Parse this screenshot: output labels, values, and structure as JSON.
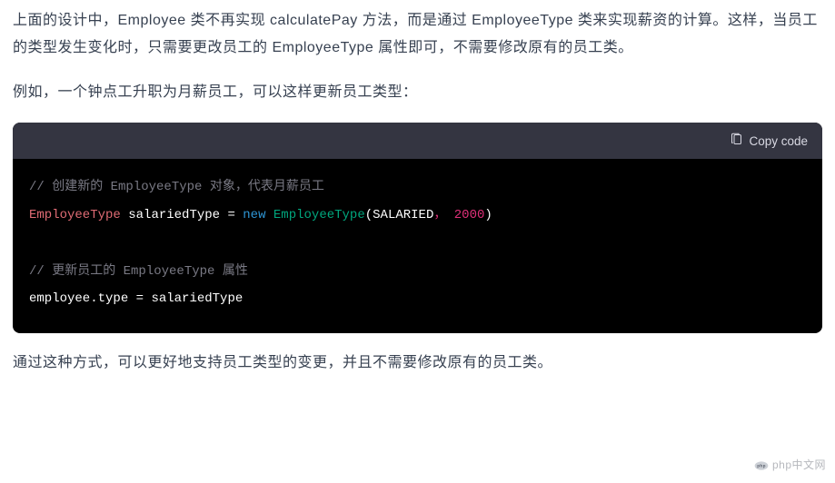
{
  "paragraphs": {
    "p1": "上面的设计中，Employee 类不再实现 calculatePay 方法，而是通过 EmployeeType 类来实现薪资的计算。这样，当员工的类型发生变化时，只需要更改员工的 EmployeeType 属性即可，不需要修改原有的员工类。",
    "p2": "例如，一个钟点工升职为月薪员工，可以这样更新员工类型：",
    "p3": "通过这种方式，可以更好地支持员工类型的变更，并且不需要修改原有的员工类。"
  },
  "code_header": {
    "copy_label": "Copy code"
  },
  "code": {
    "line1_comment": "// 创建新的 EmployeeType 对象，代表月薪员工",
    "line2": {
      "type": "EmployeeType",
      "ident": "salariedType",
      "op": "=",
      "keyword": "new",
      "class": "EmployeeType",
      "lparen": "(",
      "arg_const": "SALARIED",
      "comma": "，",
      "arg_num": "2000",
      "rparen": ")"
    },
    "line4_comment": "// 更新员工的 EmployeeType 属性",
    "line5": {
      "lhs": "employee.type",
      "op": "=",
      "rhs": "salariedType"
    }
  },
  "watermark": {
    "text": "php中文网"
  }
}
